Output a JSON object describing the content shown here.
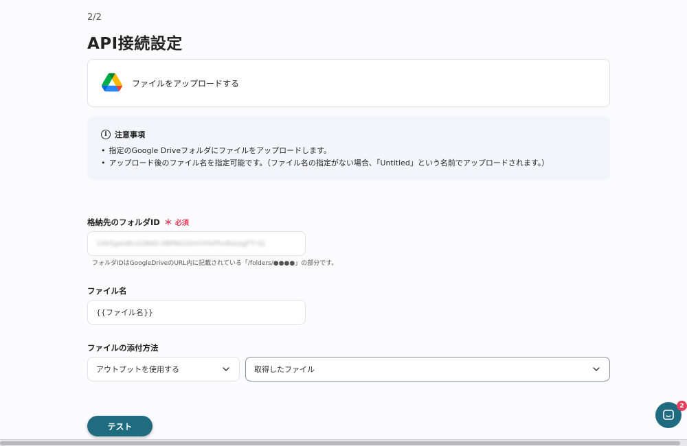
{
  "step": "2/2",
  "page_title": "API接続設定",
  "app_card": {
    "icon": "google-drive-icon",
    "action": "ファイルをアップロードする"
  },
  "notice": {
    "icon": "info-icon",
    "icon_glyph": "i",
    "title": "注意事項",
    "items": [
      "指定のGoogle Driveフォルダにファイルをアップロードします。",
      "アップロード後のファイル名を指定可能です。（ファイル名の指定がない場合、「Untitled」という名前でアップロードされます。）"
    ]
  },
  "folder_field": {
    "label": "格納先のフォルダID",
    "required_mark": "＊",
    "required_text": "必須",
    "value": "1Xk5gaoBcoi28AS-0BPAO2DmYHsPhvBzozgFT-rQ",
    "hint": "フォルダIDはGoogleDriveのURL内に記載されている「/folders/●●●●」の部分です。"
  },
  "filename_field": {
    "label": "ファイル名",
    "value": "{{ファイル名}}"
  },
  "attach_field": {
    "label": "ファイルの添付方法",
    "method_value": "アウトプットを使用する",
    "source_value": "取得したファイル"
  },
  "test_button": "テスト",
  "chat": {
    "icon": "chat-icon",
    "badge": "2"
  },
  "colors": {
    "accent": "#1f6b80",
    "required": "#e5405e",
    "notice_bg": "#f2f6fb"
  }
}
